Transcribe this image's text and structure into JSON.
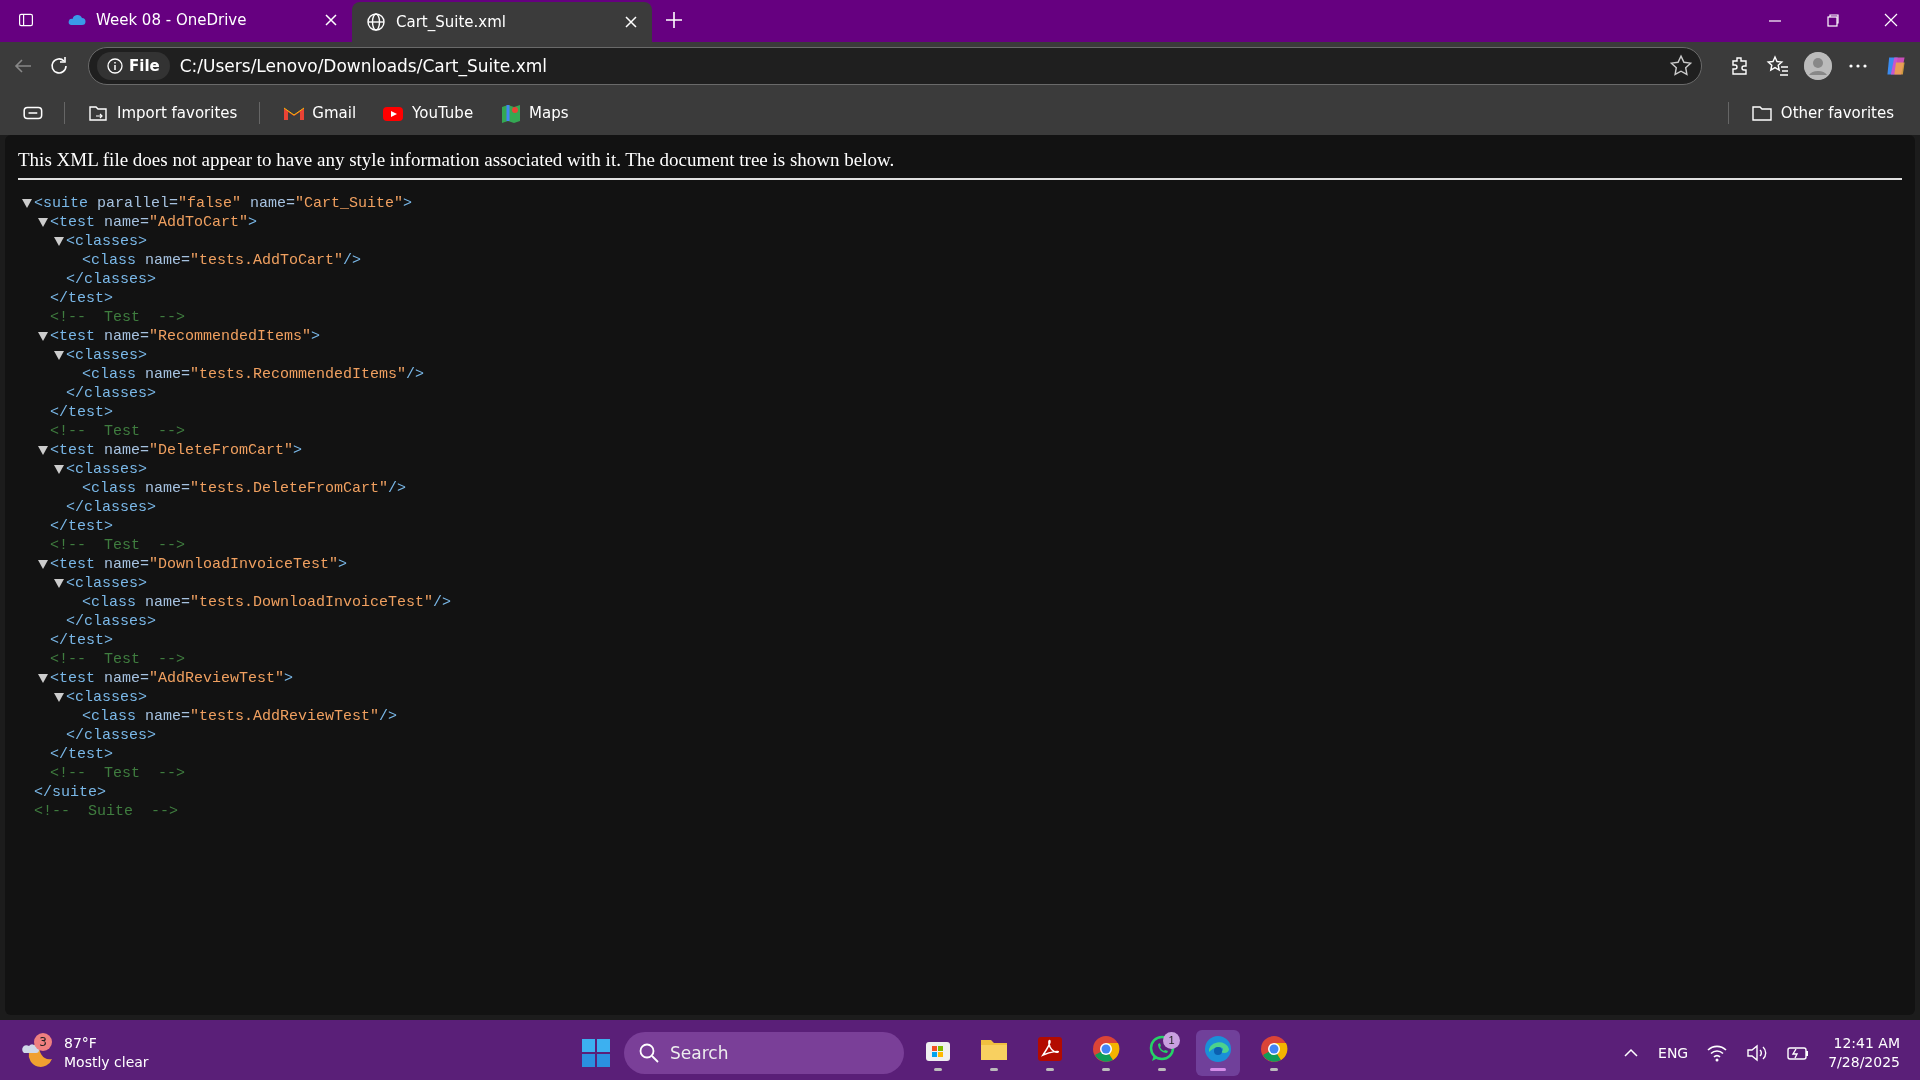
{
  "tabs": [
    {
      "kind": "cloud",
      "label": "Week 08 - OneDrive",
      "selected": false
    },
    {
      "kind": "globe",
      "label": "Cart_Suite.xml",
      "selected": true
    }
  ],
  "address_bar": {
    "scheme": "File",
    "url": "C:/Users/Lenovo/Downloads/Cart_Suite.xml"
  },
  "favorites": [
    {
      "kind": "import",
      "label": "Import favorites"
    },
    {
      "kind": "gmail",
      "label": "Gmail"
    },
    {
      "kind": "youtube",
      "label": "YouTube"
    },
    {
      "kind": "maps",
      "label": "Maps"
    }
  ],
  "other_favorites": "Other favorites",
  "xml_notice": "This XML file does not appear to have any style information associated with it. The document tree is shown below.",
  "tree": [
    {
      "kind": "element",
      "open": "<suite",
      "attributes": [
        {
          "name": "parallel=",
          "value": "\"false\""
        },
        {
          "name": "name=",
          "value": "\"Cart_Suite\""
        }
      ],
      "end": ">",
      "expanded": true,
      "close": "</suite>",
      "children": [
        {
          "kind": "element",
          "open": "<test",
          "attributes": [
            {
              "name": "name=",
              "value": "\"AddToCart\""
            }
          ],
          "end": ">",
          "expanded": true,
          "close": "</test>",
          "children": [
            {
              "kind": "element",
              "open": "<classes",
              "end": ">",
              "expanded": true,
              "close": "</classes>",
              "children": [
                {
                  "kind": "leaf",
                  "open": "<class",
                  "attributes": [
                    {
                      "name": "name=",
                      "value": "\"tests.AddToCart\""
                    }
                  ],
                  "end": "/>"
                }
              ]
            }
          ]
        },
        {
          "kind": "comment",
          "text": "<!--  Test  -->"
        },
        {
          "kind": "element",
          "open": "<test",
          "attributes": [
            {
              "name": "name=",
              "value": "\"RecommendedItems\""
            }
          ],
          "end": ">",
          "expanded": true,
          "close": "</test>",
          "children": [
            {
              "kind": "element",
              "open": "<classes",
              "end": ">",
              "expanded": true,
              "close": "</classes>",
              "children": [
                {
                  "kind": "leaf",
                  "open": "<class",
                  "attributes": [
                    {
                      "name": "name=",
                      "value": "\"tests.RecommendedItems\""
                    }
                  ],
                  "end": "/>"
                }
              ]
            }
          ]
        },
        {
          "kind": "comment",
          "text": "<!--  Test  -->"
        },
        {
          "kind": "element",
          "open": "<test",
          "attributes": [
            {
              "name": "name=",
              "value": "\"DeleteFromCart\""
            }
          ],
          "end": ">",
          "expanded": true,
          "close": "</test>",
          "children": [
            {
              "kind": "element",
              "open": "<classes",
              "end": ">",
              "expanded": true,
              "close": "</classes>",
              "children": [
                {
                  "kind": "leaf",
                  "open": "<class",
                  "attributes": [
                    {
                      "name": "name=",
                      "value": "\"tests.DeleteFromCart\""
                    }
                  ],
                  "end": "/>"
                }
              ]
            }
          ]
        },
        {
          "kind": "comment",
          "text": "<!--  Test  -->"
        },
        {
          "kind": "element",
          "open": "<test",
          "attributes": [
            {
              "name": "name=",
              "value": "\"DownloadInvoiceTest\""
            }
          ],
          "end": ">",
          "expanded": true,
          "close": "</test>",
          "children": [
            {
              "kind": "element",
              "open": "<classes",
              "end": ">",
              "expanded": true,
              "close": "</classes>",
              "children": [
                {
                  "kind": "leaf",
                  "open": "<class",
                  "attributes": [
                    {
                      "name": "name=",
                      "value": "\"tests.DownloadInvoiceTest\""
                    }
                  ],
                  "end": "/>"
                }
              ]
            }
          ]
        },
        {
          "kind": "comment",
          "text": "<!--  Test  -->"
        },
        {
          "kind": "element",
          "open": "<test",
          "attributes": [
            {
              "name": "name=",
              "value": "\"AddReviewTest\""
            }
          ],
          "end": ">",
          "expanded": true,
          "close": "</test>",
          "children": [
            {
              "kind": "element",
              "open": "<classes",
              "end": ">",
              "expanded": true,
              "close": "</classes>",
              "children": [
                {
                  "kind": "leaf",
                  "open": "<class",
                  "attributes": [
                    {
                      "name": "name=",
                      "value": "\"tests.AddReviewTest\""
                    }
                  ],
                  "end": "/>"
                }
              ]
            }
          ]
        },
        {
          "kind": "comment",
          "text": "<!--  Test  -->"
        }
      ]
    },
    {
      "kind": "comment",
      "text": "<!--  Suite  -->"
    }
  ],
  "taskbar": {
    "weather": {
      "badge": "3",
      "temperature": "87°F",
      "condition": "Mostly clear"
    },
    "search": {
      "placeholder": "Search"
    },
    "apps": [
      {
        "kind": "store",
        "selected": false
      },
      {
        "kind": "folder",
        "selected": false
      },
      {
        "kind": "pdf",
        "selected": false
      },
      {
        "kind": "chrome",
        "selected": false
      },
      {
        "kind": "whatsapp",
        "selected": false,
        "badge": "1"
      },
      {
        "kind": "edge",
        "selected": true
      },
      {
        "kind": "chrome",
        "selected": false
      }
    ],
    "language": "ENG",
    "time": "12:41 AM",
    "date": "7/28/2025"
  }
}
